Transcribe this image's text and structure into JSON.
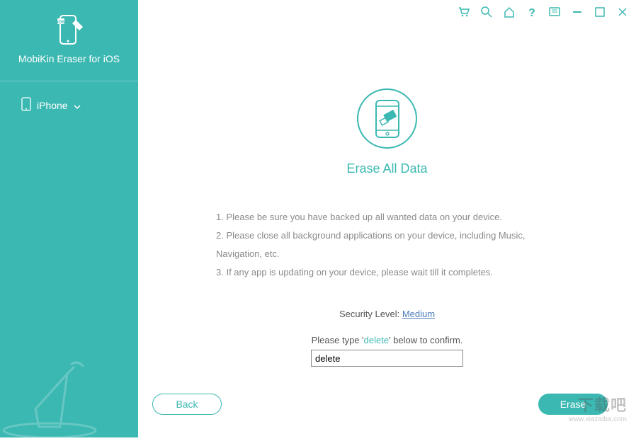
{
  "app": {
    "name": "MobiKin Eraser for iOS"
  },
  "sidebar": {
    "device_label": "iPhone"
  },
  "toolbar": {
    "cart": "cart-icon",
    "search": "search-icon",
    "home": "home-icon",
    "help": "help-icon",
    "feedback": "feedback-icon",
    "minimize": "minimize-icon",
    "maximize": "maximize-icon",
    "close": "close-icon"
  },
  "main": {
    "title": "Erase All Data",
    "instructions": [
      "1. Please be sure you have backed up all wanted data on your device.",
      "2. Please close all background applications on your device, including Music, Navigation, etc.",
      "3. If any app is updating on your device, please wait till it completes."
    ],
    "security_label": "Security Level: ",
    "security_value": "Medium",
    "confirm_prefix": "Please type '",
    "confirm_keyword": "delete",
    "confirm_suffix": "' below to confirm.",
    "input_value": "delete"
  },
  "buttons": {
    "back": "Back",
    "erase": "Erase"
  },
  "watermark": {
    "line1": "下载吧",
    "line2": "www.xiazaiba.com"
  },
  "colors": {
    "accent": "#3cb8b2",
    "link": "#4a7bb8"
  }
}
